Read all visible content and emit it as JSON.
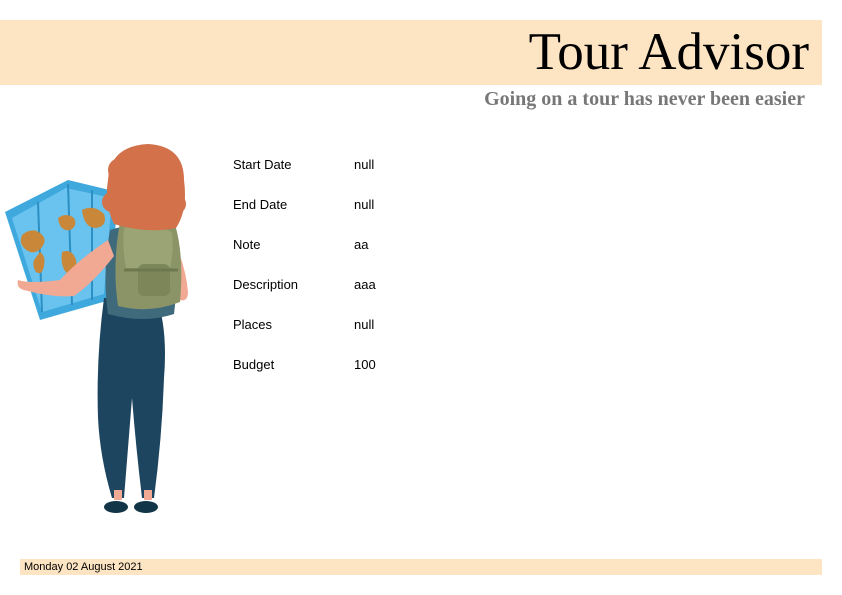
{
  "header": {
    "title": "Tour Advisor",
    "subtitle": "Going on a tour has never been easier",
    "band_color": "#fde5c4"
  },
  "illustration": {
    "icon": "traveler-with-map-icon"
  },
  "fields": [
    {
      "label": "Start Date",
      "value": "null"
    },
    {
      "label": "End Date",
      "value": "null"
    },
    {
      "label": "Note",
      "value": "aa"
    },
    {
      "label": "Description",
      "value": "aaa"
    },
    {
      "label": "Places",
      "value": "null"
    },
    {
      "label": "Budget",
      "value": "100"
    }
  ],
  "footer": {
    "date": "Monday 02 August 2021"
  }
}
